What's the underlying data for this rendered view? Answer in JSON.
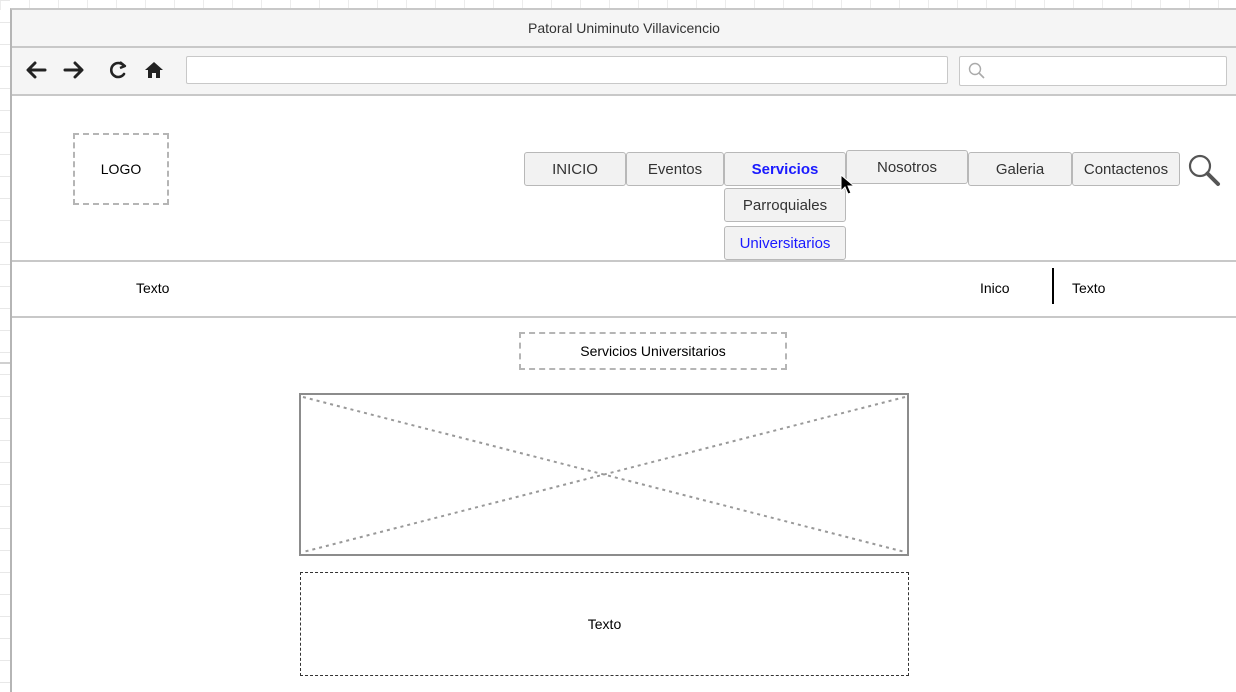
{
  "window": {
    "title": "Patoral Uniminuto Villavicencio"
  },
  "toolbar": {
    "icons": [
      "back-arrow-icon",
      "forward-arrow-icon",
      "reload-icon",
      "home-icon"
    ],
    "url_value": "",
    "search_value": ""
  },
  "header": {
    "logo_label": "LOGO",
    "menu": [
      {
        "label": "INICIO"
      },
      {
        "label": "Eventos"
      },
      {
        "label": "Servicios",
        "state": "active"
      },
      {
        "label": "Nosotros"
      },
      {
        "label": "Galeria"
      },
      {
        "label": "Contactenos"
      }
    ],
    "submenu": [
      {
        "label": "Parroquiales"
      },
      {
        "label": "Universitarios",
        "state": "selected"
      }
    ],
    "accent_color": "#1a1aff"
  },
  "breadcrumb": {
    "left_text": "Texto",
    "home_label": "Inico",
    "current_text": "Texto"
  },
  "content": {
    "section_title": "Servicios Universitarios",
    "text_box": "Texto"
  }
}
